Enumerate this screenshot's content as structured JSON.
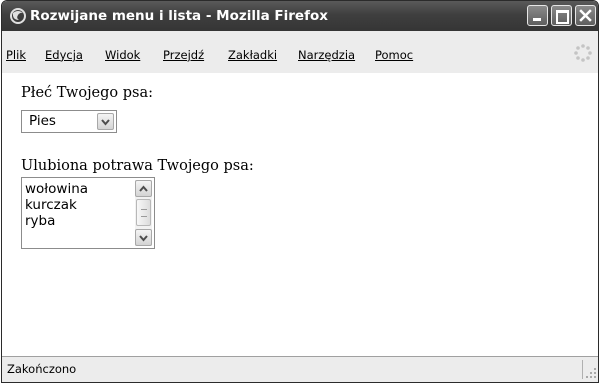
{
  "window": {
    "title": "Rozwijane menu i lista - Mozilla Firefox",
    "app_icon": "firefox-icon"
  },
  "menu": {
    "items": [
      {
        "label": "Plik"
      },
      {
        "label": "Edycja"
      },
      {
        "label": "Widok"
      },
      {
        "label": "Przejdź"
      },
      {
        "label": "Zakładki"
      },
      {
        "label": "Narzędzia"
      },
      {
        "label": "Pomoc"
      }
    ]
  },
  "form": {
    "gender_label": "Płeć Twojego psa:",
    "gender_selected": "Pies",
    "food_label": "Ulubiona potrawa Twojego psa:",
    "food_options": [
      "wołowina",
      "kurczak",
      "ryba"
    ]
  },
  "status": {
    "text": "Zakończono"
  },
  "colors": {
    "titlebar": "#3f3f3f",
    "menubar": "#ececec",
    "content": "#ffffff"
  }
}
